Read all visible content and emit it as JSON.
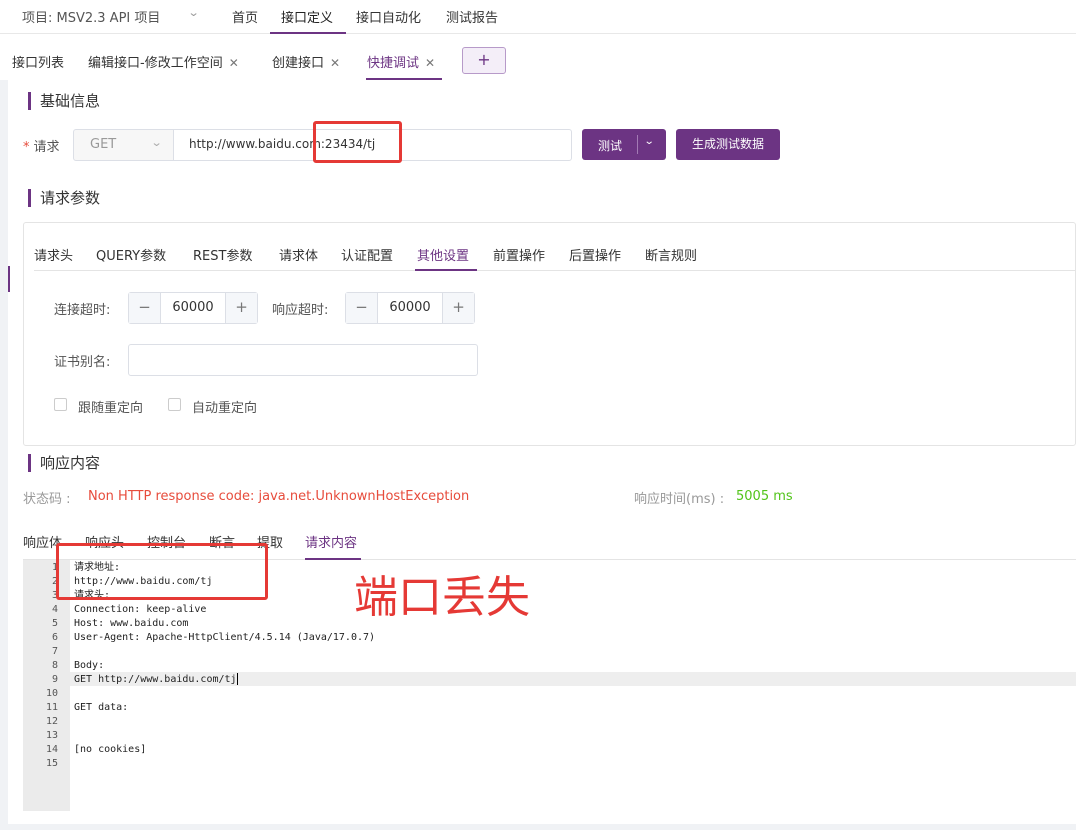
{
  "topnav": {
    "project": "项目: MSV2.3 API 项目",
    "items": [
      "首页",
      "接口定义",
      "接口自动化",
      "测试报告"
    ]
  },
  "tabs": {
    "items": [
      {
        "label": "接口列表",
        "closable": false
      },
      {
        "label": "编辑接口-修改工作空间",
        "closable": true
      },
      {
        "label": "创建接口",
        "closable": true
      },
      {
        "label": "快捷调试",
        "closable": true
      }
    ],
    "add_label": "+"
  },
  "basic": {
    "title": "基础信息",
    "request_label": "请求",
    "method": "GET",
    "url": "http://www.baidu.com:23434/tj",
    "test_button": "测试",
    "generate_button": "生成测试数据"
  },
  "params": {
    "title": "请求参数",
    "tabs": [
      "请求头",
      "QUERY参数",
      "REST参数",
      "请求体",
      "认证配置",
      "其他设置",
      "前置操作",
      "后置操作",
      "断言规则"
    ],
    "connect_timeout_label": "连接超时:",
    "connect_timeout": "60000",
    "response_timeout_label": "响应超时:",
    "response_timeout": "60000",
    "cert_alias_label": "证书别名:",
    "cert_alias": "",
    "follow_redirect": "跟随重定向",
    "auto_redirect": "自动重定向"
  },
  "response": {
    "title": "响应内容",
    "status_label": "状态码 :",
    "status_value": "Non HTTP response code: java.net.UnknownHostException",
    "time_label": "响应时间(ms) :",
    "time_value": "5005 ms",
    "tabs": [
      "响应体",
      "响应头",
      "控制台",
      "断言",
      "提取",
      "请求内容"
    ],
    "lines": [
      "请求地址:",
      "http://www.baidu.com/tj",
      "请求头:",
      "Connection: keep-alive",
      "Host: www.baidu.com",
      "User-Agent: Apache-HttpClient/4.5.14 (Java/17.0.7)",
      "",
      "Body:",
      "GET http://www.baidu.com/tj",
      "",
      "GET data:",
      "",
      "",
      "[no cookies]",
      ""
    ]
  },
  "annotation": "端口丢失",
  "colors": {
    "accent": "#6c3483",
    "error": "#e74c3c",
    "success": "#52c41a",
    "annotation": "#e53935"
  }
}
